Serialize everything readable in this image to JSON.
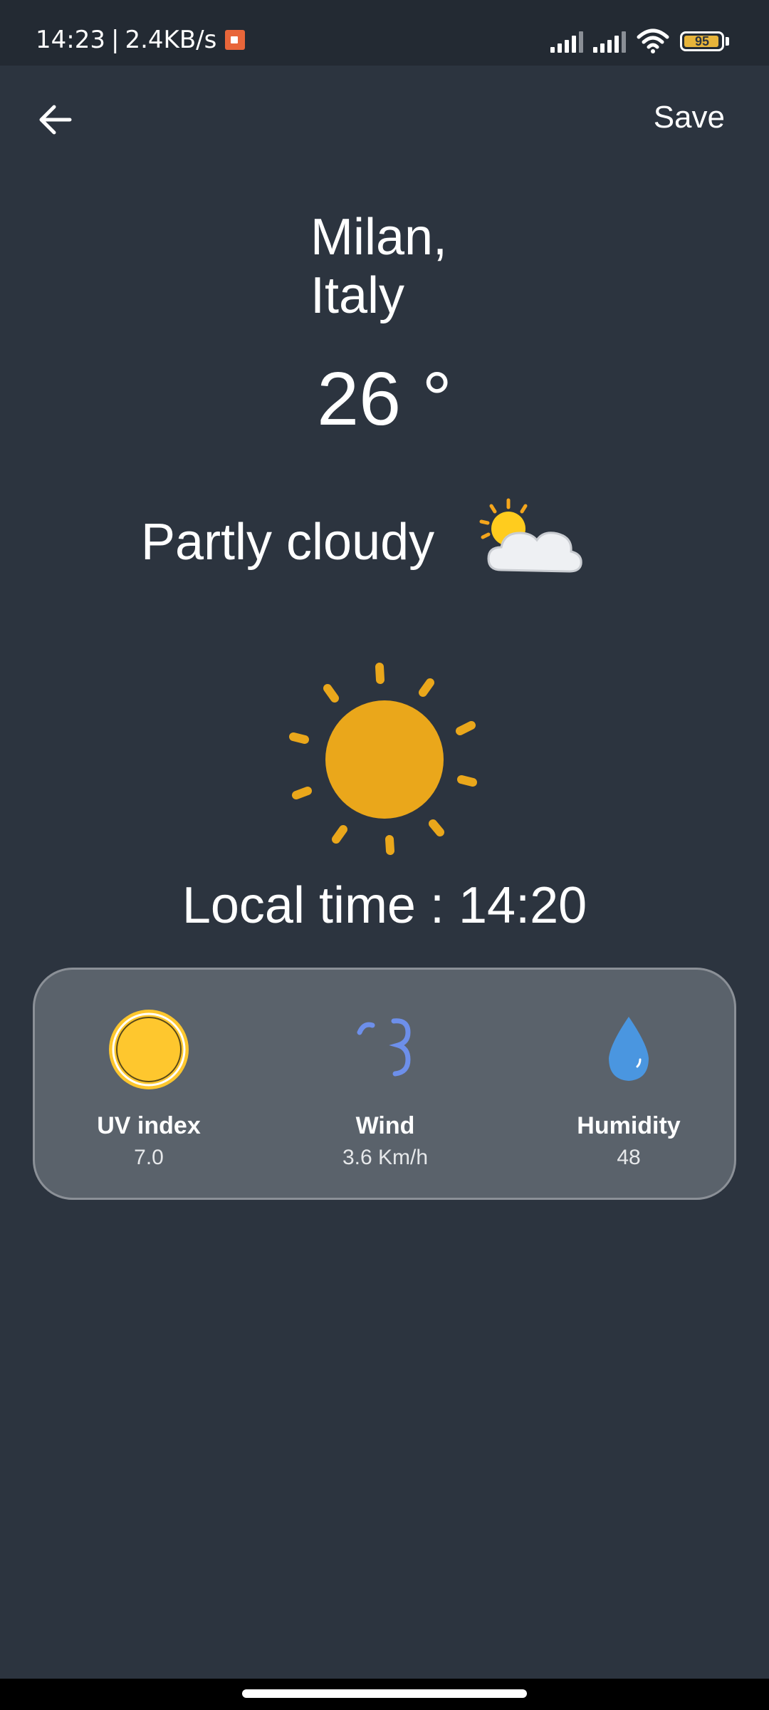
{
  "status_bar": {
    "time": "14:23",
    "separator": "|",
    "net_speed": "2.4KB/s",
    "battery": "95",
    "battery_fraction": 0.95,
    "icons": [
      "screen-record-icon",
      "signal-icon",
      "signal-icon",
      "wifi-icon",
      "battery-icon"
    ]
  },
  "header": {
    "back_icon": "arrow-left-icon",
    "save_label": "Save"
  },
  "weather": {
    "city_line1": "Milan,",
    "city_line2": "Italy",
    "temperature": "26 °",
    "condition": "Partly cloudy",
    "condition_icon": "sun-behind-cloud-icon",
    "illustration": "sun-icon",
    "local_time": "Local time : 14:20"
  },
  "metrics": [
    {
      "label": "UV index",
      "value": "7.0",
      "icon": "uv-sun-icon"
    },
    {
      "label": "Wind",
      "value": "3.6 Km/h",
      "icon": "wind-icon"
    },
    {
      "label": "Humidity",
      "value": "48",
      "icon": "water-drop-icon"
    }
  ],
  "colors": {
    "background": "#2c343f",
    "status_bar": "#232a33",
    "card": "#5a626b",
    "sun": "#eaa71b",
    "uv": "#fec72e",
    "wind": "#6d8fea",
    "drop": "#4a96e0"
  }
}
